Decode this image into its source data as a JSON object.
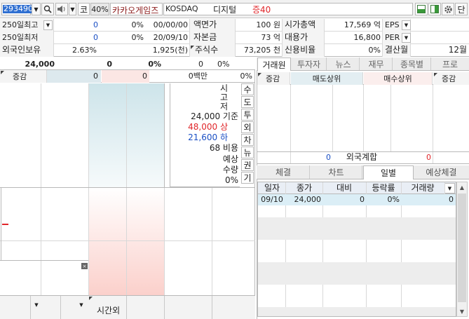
{
  "toolbar": {
    "code": "293490",
    "market_letter": "코",
    "margin": "40%",
    "name": "카카오게임즈",
    "market": "KOSDAQ",
    "sector": "디지털",
    "margin_tag": "증40",
    "single_label": "단"
  },
  "info": {
    "r1": {
      "l1": "250일최고",
      "v1": "0",
      "p1": "0%",
      "d1": "00/00/00",
      "l2": "액면가",
      "v2": "100 원",
      "l3": "시가총액",
      "v3": "17,569 억",
      "l4": "EPS",
      "v4": ""
    },
    "r2": {
      "l1": "250일최저",
      "v1": "0",
      "p1": "0%",
      "d1": "20/09/10",
      "l2": "자본금",
      "v2": "73 억",
      "l3": "대용가",
      "v3": "16,800",
      "l4": "PER",
      "v4": ""
    },
    "r3": {
      "l1": "외국인보유",
      "v1": "2.63%",
      "v1b": "1,925(천)",
      "l2": "주식수",
      "v2": "73,205 천",
      "l3": "신용비율",
      "v3": "0%",
      "l4": "결산월",
      "v4": "12월"
    }
  },
  "quote": {
    "price": "24,000",
    "change": "0",
    "pct": "0%",
    "vol": "0",
    "vol_unit": "0%",
    "diff_label": "증감",
    "sell_sum": "0",
    "buy_sum": "0",
    "amount": "0백만",
    "amount_pct": "0%"
  },
  "side": {
    "labels": [
      "시",
      "고",
      "저"
    ],
    "base": "24,000 기준",
    "upper": "48,000 상",
    "lower": "21,600 하",
    "cost": "68 비용",
    "exp1": "예상",
    "exp2": "수량",
    "exp_pct": "0%",
    "vtabs": [
      "수",
      "도",
      "투",
      "외",
      "차",
      "뉴",
      "권",
      "기"
    ]
  },
  "after_hours": "시간외",
  "right": {
    "tabs": [
      "거래원",
      "투자자",
      "뉴스",
      "재무",
      "종목별",
      "프로"
    ],
    "head": {
      "diff1": "증감",
      "sell": "매도상위",
      "buy": "매수상위",
      "diff2": "증감"
    },
    "foreign_label": "외국계합",
    "foreign_sell": "0",
    "foreign_buy": "0",
    "tabs2": [
      "체결",
      "차트",
      "일별",
      "예상체결"
    ],
    "table": {
      "headers": [
        "일자",
        "종가",
        "대비",
        "등락률",
        "거래량"
      ],
      "rows": [
        [
          "09/10",
          "24,000",
          "0",
          "0%",
          "0"
        ]
      ]
    }
  },
  "colors": {
    "accent": "#1e5fb5",
    "up": "#e0262a",
    "down": "#1a4fc4",
    "ask": "#cfe6ec",
    "bid": "#f8cfcb"
  }
}
